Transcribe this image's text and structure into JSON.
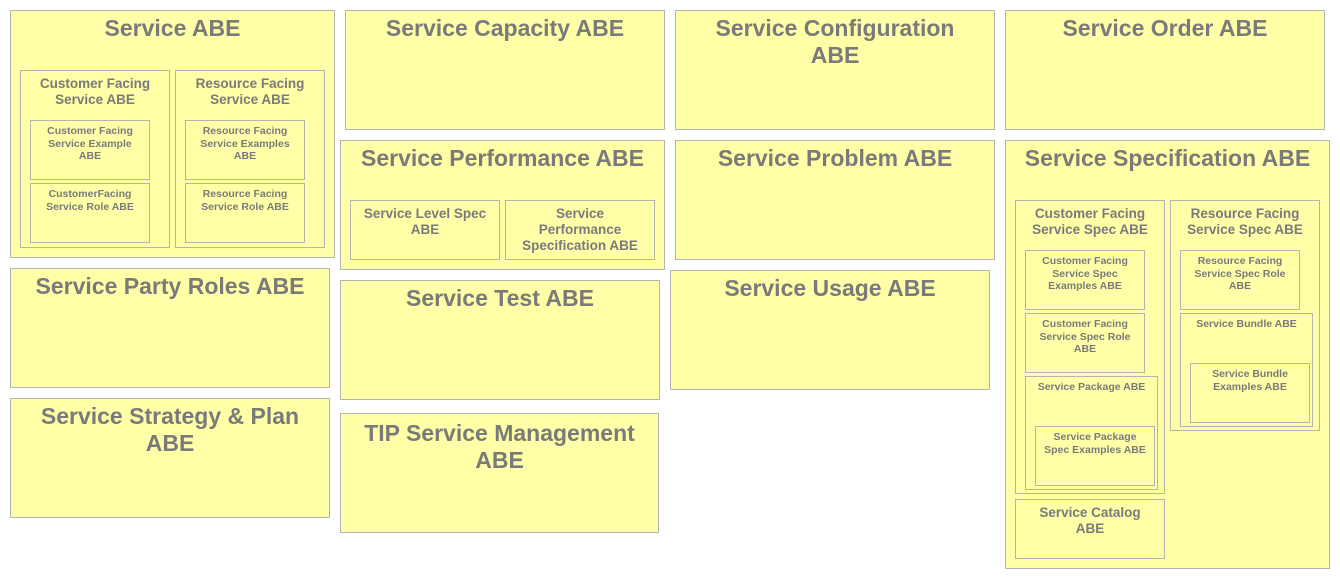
{
  "service_abe": {
    "title": "Service ABE",
    "customer_facing": {
      "title": "Customer Facing Service ABE",
      "example": "Customer Facing Service Example ABE",
      "role": "CustomerFacing Service Role ABE"
    },
    "resource_facing": {
      "title": "Resource Facing Service ABE",
      "examples": "Resource Facing Service Examples ABE",
      "role": "Resource Facing Service Role ABE"
    }
  },
  "service_capacity": {
    "title": "Service Capacity ABE"
  },
  "service_configuration": {
    "title": "Service Configuration ABE"
  },
  "service_order": {
    "title": "Service Order ABE"
  },
  "service_performance": {
    "title": "Service Performance ABE",
    "level_spec": "Service Level Spec ABE",
    "perf_spec": "Service Performance Specification ABE"
  },
  "service_problem": {
    "title": "Service Problem ABE"
  },
  "service_specification": {
    "title": "Service Specification ABE",
    "cfs_spec": {
      "title": "Customer Facing Service Spec ABE",
      "examples": "Customer Facing Service Spec Examples ABE",
      "role": "Customer Facing Service Spec Role ABE",
      "package": {
        "title": "Service Package ABE",
        "examples": "Service Package Spec Examples ABE"
      }
    },
    "rfs_spec": {
      "title": "Resource Facing Service Spec ABE",
      "role": "Resource Facing Service Spec Role ABE",
      "bundle": {
        "title": "Service Bundle ABE",
        "examples": "Service Bundle Examples ABE"
      }
    },
    "catalog": "Service Catalog ABE"
  },
  "service_party_roles": {
    "title": "Service Party Roles ABE"
  },
  "service_test": {
    "title": "Service Test ABE"
  },
  "service_usage": {
    "title": "Service Usage ABE"
  },
  "service_strategy": {
    "title": "Service Strategy & Plan ABE"
  },
  "tip_service_mgmt": {
    "title": "TIP Service Management ABE"
  },
  "colors": {
    "fill": "#ffffa8",
    "border": "#b4b4b4",
    "text": "#7a7a7a"
  }
}
